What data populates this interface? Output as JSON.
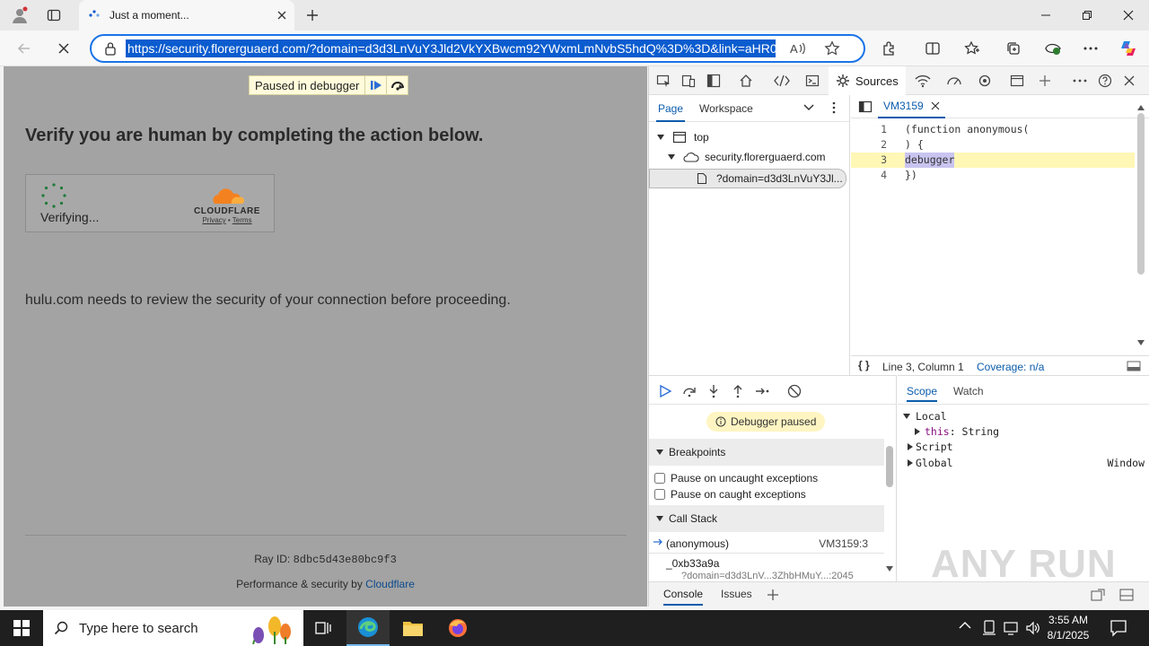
{
  "browser": {
    "tab_title": "Just a moment...",
    "url": "https://security.florerguaerd.com/?domain=d3d3LnVuY3Jld2VkYXBwcm92YWxmLmNvbS5hdQ%3D%3D&link=aHR0cH"
  },
  "page": {
    "paused_label": "Paused in debugger",
    "heading": "Verify you are human by completing the action below.",
    "verifying": "Verifying...",
    "cf_name": "CLOUDFLARE",
    "cf_privacy": "Privacy",
    "cf_sep": " • ",
    "cf_terms": "Terms",
    "security_message": "hulu.com needs to review the security of your connection before proceeding.",
    "ray_label": "Ray ID: ",
    "ray_id": "8dbc5d43e80bc9f3",
    "perf_prefix": "Performance & security by ",
    "perf_link": "Cloudflare"
  },
  "devtools": {
    "active_tab": "Sources",
    "navigator": {
      "tabs": [
        "Page",
        "Workspace"
      ],
      "tree": {
        "top": "top",
        "domain": "security.florerguaerd.com",
        "file": "?domain=d3d3LnVuY3Jl..."
      }
    },
    "editor": {
      "tab": "VM3159",
      "lines": [
        {
          "n": "1",
          "text": "(function anonymous("
        },
        {
          "n": "2",
          "text": ") {"
        },
        {
          "n": "3",
          "text": "debugger"
        },
        {
          "n": "4",
          "text": "})"
        }
      ],
      "status_braces": "{ }",
      "status_position": "Line 3, Column 1",
      "status_coverage": "Coverage: n/a"
    },
    "debugger": {
      "paused_pill": "Debugger paused",
      "breakpoints_header": "Breakpoints",
      "pause_uncaught": "Pause on uncaught exceptions",
      "pause_caught": "Pause on caught exceptions",
      "callstack_header": "Call Stack",
      "frames": [
        {
          "name": "(anonymous)",
          "location": "VM3159:3"
        },
        {
          "name": "_0xb33a9a",
          "location": "?domain=d3d3LnV...3ZhbHMuY...:2045"
        }
      ]
    },
    "scope": {
      "tabs": [
        "Scope",
        "Watch"
      ],
      "local": "Local",
      "this_key": "this",
      "this_val": ": String",
      "script": "Script",
      "global": "Global",
      "global_val": "Window"
    },
    "drawer": {
      "tabs": [
        "Console",
        "Issues"
      ]
    }
  },
  "taskbar": {
    "search_placeholder": "Type here to search",
    "time": "3:55 AM",
    "date": "8/1/2025"
  },
  "watermark": "ANY RUN"
}
